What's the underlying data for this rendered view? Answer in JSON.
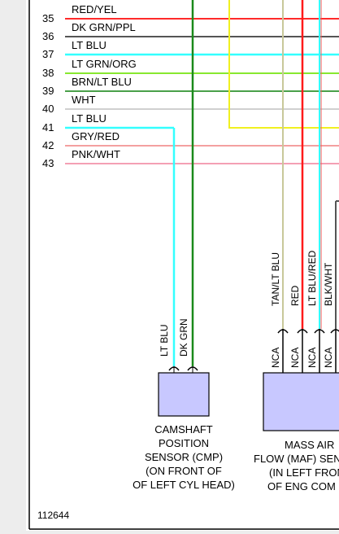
{
  "rows": [
    {
      "pin": "35",
      "label": "RED/YEL",
      "color": "#ff2a2a"
    },
    {
      "pin": "36",
      "label": "DK GRN/PPL",
      "color": "#555555"
    },
    {
      "pin": "37",
      "label": "LT BLU",
      "color": "#33ffff"
    },
    {
      "pin": "38",
      "label": "LT GRN/ORG",
      "color": "#88e830"
    },
    {
      "pin": "39",
      "label": "BRN/LT BLU",
      "color": "#4aa04a"
    },
    {
      "pin": "40",
      "label": "WHT",
      "color": "#d8d8d8"
    },
    {
      "pin": "41",
      "label": "LT BLU",
      "color": "#33ffff"
    },
    {
      "pin": "42",
      "label": "GRY/RED",
      "color": "#f4a0a0"
    },
    {
      "pin": "43",
      "label": "PNK/WHT",
      "color": "#f4a0b4"
    }
  ],
  "cmp": {
    "wire_labels": [
      "LT BLU",
      "DK GRN"
    ],
    "caption": [
      "CAMSHAFT",
      "POSITION",
      "SENSOR (CMP)",
      "(ON FRONT OF",
      "OF LEFT CYL HEAD)"
    ]
  },
  "maf": {
    "wire_labels": [
      "TAN/LT BLU",
      "RED",
      "LT BLU/RED",
      "BLK/WHT"
    ],
    "nca_labels": [
      "NCA",
      "NCA",
      "NCA",
      "NCA"
    ],
    "caption": [
      "MASS AIR",
      "FLOW (MAF) SEN",
      "(IN LEFT FRON",
      "OF ENG COM"
    ]
  },
  "figure_number": "112644",
  "colors": {
    "lt_blu": "#33ffff",
    "dk_grn": "#1a8a1a",
    "yellow": "#f0f020",
    "red": "#ff1a1a",
    "tan": "#c8c89a",
    "sensor_fill": "#c8c8ff"
  }
}
